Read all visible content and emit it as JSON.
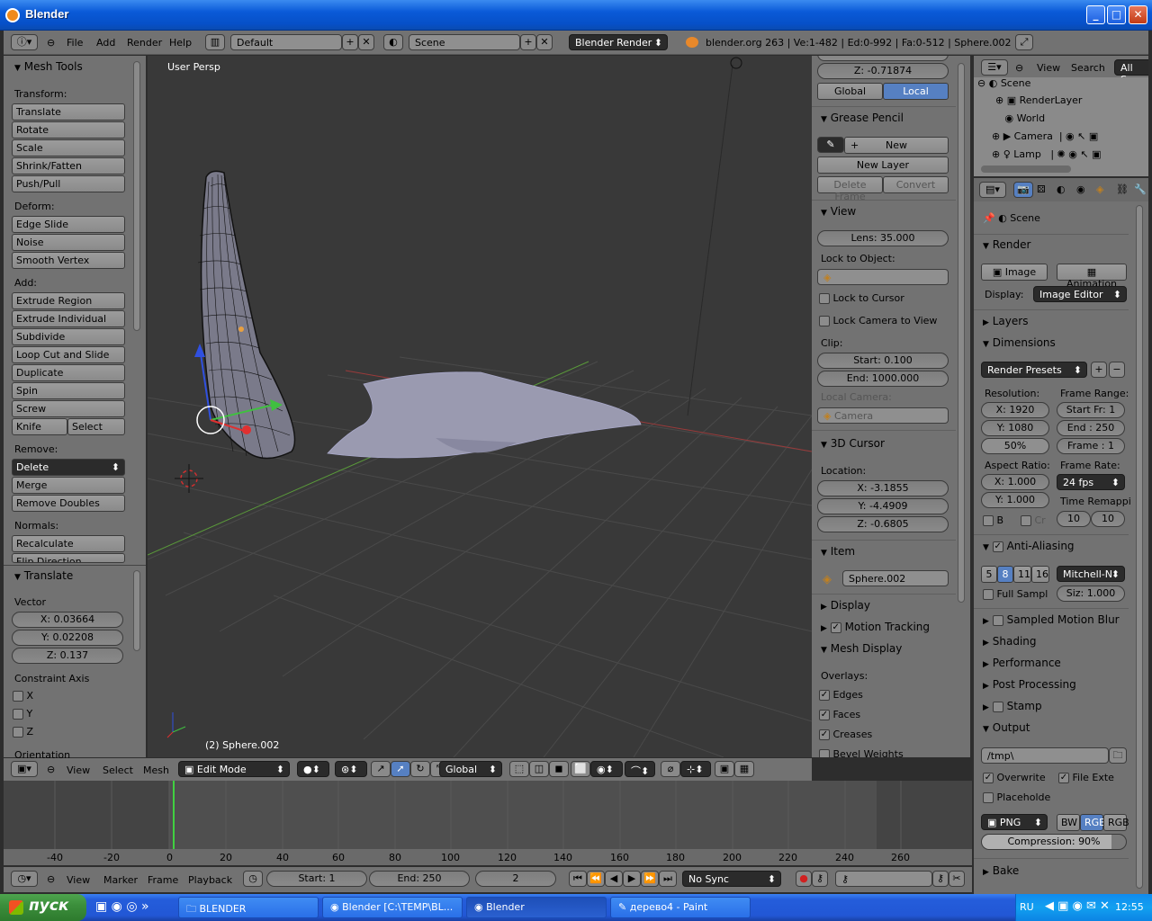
{
  "window": {
    "title": "Blender"
  },
  "header": {
    "menus": [
      "File",
      "Add",
      "Render",
      "Help"
    ],
    "screen_layout": "Default",
    "scene": "Scene",
    "engine": "Blender Render",
    "stats": "blender.org 263 | Ve:1-482 | Ed:0-992 | Fa:0-512 | Sphere.002"
  },
  "toolshelf": {
    "title": "Mesh Tools",
    "transform_label": "Transform:",
    "transform": [
      "Translate",
      "Rotate",
      "Scale",
      "Shrink/Fatten",
      "Push/Pull"
    ],
    "deform_label": "Deform:",
    "deform": [
      "Edge Slide",
      "Noise",
      "Smooth Vertex"
    ],
    "add_label": "Add:",
    "add": [
      "Extrude Region",
      "Extrude Individual",
      "Subdivide",
      "Loop Cut and Slide",
      "Duplicate",
      "Spin",
      "Screw"
    ],
    "knife": "Knife",
    "select": "Select",
    "remove_label": "Remove:",
    "delete": "Delete",
    "merge": "Merge",
    "remove_doubles": "Remove Doubles",
    "normals_label": "Normals:",
    "recalculate": "Recalculate",
    "flip_direction": "Flip Direction"
  },
  "operator": {
    "title": "Translate",
    "vector_label": "Vector",
    "x": "X: 0.03664",
    "y": "Y: 0.02208",
    "z": "Z: 0.137",
    "constraint_label": "Constraint Axis",
    "axes": [
      "X",
      "Y",
      "Z"
    ],
    "orientation_label": "Orientation"
  },
  "viewport": {
    "label": "User Persp",
    "object": "(2) Sphere.002"
  },
  "properties_n": {
    "z_value": "Z: -0.71874",
    "global": "Global",
    "local": "Local",
    "grease_title": "Grease Pencil",
    "new": "New",
    "new_layer": "New Layer",
    "delete_frame": "Delete Frame",
    "convert": "Convert",
    "view_title": "View",
    "lens": "Lens: 35.000",
    "lock_to_object": "Lock to Object:",
    "lock_cursor": "Lock to Cursor",
    "lock_camera": "Lock Camera to View",
    "clip_label": "Clip:",
    "clip_start": "Start: 0.100",
    "clip_end": "End: 1000.000",
    "local_camera": "Local Camera:",
    "camera": "Camera",
    "cursor_title": "3D Cursor",
    "location_label": "Location:",
    "cx": "X: -3.1855",
    "cy": "Y: -4.4909",
    "cz": "Z: -0.6805",
    "item_title": "Item",
    "item_name": "Sphere.002",
    "display_title": "Display",
    "motion_title": "Motion Tracking",
    "mesh_display_title": "Mesh Display",
    "overlays_label": "Overlays:",
    "overlays": [
      "Edges",
      "Faces",
      "Creases",
      "Bevel Weights"
    ]
  },
  "outliner": {
    "view": "View",
    "search": "Search",
    "all_scenes": "All Sce",
    "items": [
      "Scene",
      "RenderLayer",
      "World",
      "Camera",
      "Lamp"
    ]
  },
  "render_props": {
    "scene": "Scene",
    "render_title": "Render",
    "image": "Image",
    "animation": "Animation",
    "display_label": "Display:",
    "display_value": "Image Editor",
    "layers": "Layers",
    "dimensions": "Dimensions",
    "presets": "Render Presets",
    "resolution_label": "Resolution:",
    "res_x": "X: 1920",
    "res_y": "Y: 1080",
    "res_pct": "50%",
    "frame_range_label": "Frame Range:",
    "start_fr": "Start Fr: 1",
    "end_fr": "End : 250",
    "frame_step": "Frame : 1",
    "aspect_label": "Aspect Ratio:",
    "asp_x": "X: 1.000",
    "asp_y": "Y: 1.000",
    "frame_rate_label": "Frame Rate:",
    "fps": "24 fps",
    "time_remap": "Time Remappi",
    "remap_old": "10",
    "remap_new": "10",
    "b": "B",
    "cr": "Cr",
    "antialiasing": "Anti-Aliasing",
    "aa_samples": [
      "5",
      "8",
      "11",
      "16"
    ],
    "aa_filter": "Mitchell-N",
    "full_sample": "Full Sampl",
    "filter_size": "Siz: 1.000",
    "motion_blur": "Sampled Motion Blur",
    "shading": "Shading",
    "performance": "Performance",
    "post_processing": "Post Processing",
    "stamp": "Stamp",
    "output": "Output",
    "output_path": "/tmp\\",
    "overwrite": "Overwrite",
    "file_ext": "File Exte",
    "placeholder": "Placeholde",
    "format": "PNG",
    "bw": "BW",
    "rgb": "RGB",
    "rgba": "RGB",
    "compression": "Compression: 90%",
    "bake": "Bake"
  },
  "view3d_header": {
    "view": "View",
    "select": "Select",
    "mesh": "Mesh",
    "mode": "Edit Mode",
    "orientation": "Global"
  },
  "timeline": {
    "ticks": [
      "-40",
      "-20",
      "0",
      "20",
      "40",
      "60",
      "80",
      "100",
      "120",
      "140",
      "160",
      "180",
      "200",
      "220",
      "240",
      "260"
    ],
    "view": "View",
    "marker": "Marker",
    "frame": "Frame",
    "playback": "Playback",
    "start": "Start: 1",
    "end": "End: 250",
    "current": "2",
    "sync": "No Sync"
  },
  "taskbar": {
    "start": "пуск",
    "tasks": [
      "BLENDER",
      "Blender [C:\\TEMP\\BL...",
      "Blender",
      "дерево4 - Paint"
    ],
    "lang": "RU",
    "clock": "12:55"
  },
  "colors": {
    "accent": "#5680c2",
    "panel": "#727272",
    "viewport": "#393939"
  }
}
